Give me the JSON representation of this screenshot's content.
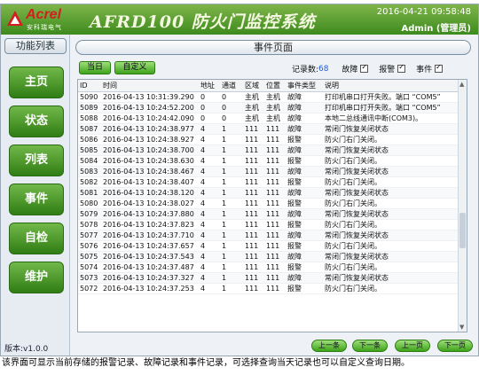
{
  "header": {
    "logo_text": "Acrel",
    "logo_sub": "安科瑞电气",
    "app_title": "AFRD100  防火门监控系统",
    "datetime": "2016-04-21 09:58:48",
    "user": "Admin (管理员)",
    "colors": {
      "bar": "#3d8a1e",
      "logo": "#d21f1f"
    }
  },
  "sidebar": {
    "title": "功能列表",
    "items": [
      {
        "label": "主页"
      },
      {
        "label": "状态"
      },
      {
        "label": "列表"
      },
      {
        "label": "事件"
      },
      {
        "label": "自检"
      },
      {
        "label": "维护"
      }
    ],
    "version": "版本:v1.0.0"
  },
  "main": {
    "page_title": "事件页面",
    "today_btn": "当日",
    "custom_btn": "自定义",
    "record_count_label": "记录数:",
    "record_count": "68",
    "filters": [
      {
        "label": "故障",
        "checked": true
      },
      {
        "label": "报警",
        "checked": true
      },
      {
        "label": "事件",
        "checked": true
      }
    ],
    "columns": [
      "ID",
      "时间",
      "地址",
      "通道",
      "区域",
      "位置",
      "事件类型",
      "说明"
    ],
    "rows": [
      [
        "5090",
        "2016-04-13 10:31:39.290",
        "0",
        "0",
        "主机",
        "主机",
        "故障",
        "打印机串口打开失败。端口 “COM5”"
      ],
      [
        "5089",
        "2016-04-13 10:24:52.200",
        "0",
        "0",
        "主机",
        "主机",
        "故障",
        "打印机串口打开失败。端口 “COM5”"
      ],
      [
        "5088",
        "2016-04-13 10:24:42.090",
        "0",
        "0",
        "主机",
        "主机",
        "故障",
        "本地二总线通讯中断(COM3)。"
      ],
      [
        "5087",
        "2016-04-13 10:24:38.977",
        "4",
        "1",
        "111",
        "111",
        "故障",
        "常闭门恢复关闭状态"
      ],
      [
        "5086",
        "2016-04-13 10:24:38.927",
        "4",
        "1",
        "111",
        "111",
        "报警",
        "防火门右门关闭。"
      ],
      [
        "5085",
        "2016-04-13 10:24:38.700",
        "4",
        "1",
        "111",
        "111",
        "故障",
        "常闭门恢复关闭状态"
      ],
      [
        "5084",
        "2016-04-13 10:24:38.630",
        "4",
        "1",
        "111",
        "111",
        "报警",
        "防火门右门关闭。"
      ],
      [
        "5083",
        "2016-04-13 10:24:38.467",
        "4",
        "1",
        "111",
        "111",
        "故障",
        "常闭门恢复关闭状态"
      ],
      [
        "5082",
        "2016-04-13 10:24:38.407",
        "4",
        "1",
        "111",
        "111",
        "报警",
        "防火门右门关闭。"
      ],
      [
        "5081",
        "2016-04-13 10:24:38.120",
        "4",
        "1",
        "111",
        "111",
        "故障",
        "常闭门恢复关闭状态"
      ],
      [
        "5080",
        "2016-04-13 10:24:38.027",
        "4",
        "1",
        "111",
        "111",
        "报警",
        "防火门右门关闭。"
      ],
      [
        "5079",
        "2016-04-13 10:24:37.880",
        "4",
        "1",
        "111",
        "111",
        "故障",
        "常闭门恢复关闭状态"
      ],
      [
        "5078",
        "2016-04-13 10:24:37.823",
        "4",
        "1",
        "111",
        "111",
        "报警",
        "防火门右门关闭。"
      ],
      [
        "5077",
        "2016-04-13 10:24:37.710",
        "4",
        "1",
        "111",
        "111",
        "故障",
        "常闭门恢复关闭状态"
      ],
      [
        "5076",
        "2016-04-13 10:24:37.657",
        "4",
        "1",
        "111",
        "111",
        "报警",
        "防火门右门关闭。"
      ],
      [
        "5075",
        "2016-04-13 10:24:37.543",
        "4",
        "1",
        "111",
        "111",
        "故障",
        "常闭门恢复关闭状态"
      ],
      [
        "5074",
        "2016-04-13 10:24:37.487",
        "4",
        "1",
        "111",
        "111",
        "报警",
        "防火门右门关闭。"
      ],
      [
        "5073",
        "2016-04-13 10:24:37.327",
        "4",
        "1",
        "111",
        "111",
        "故障",
        "常闭门恢复关闭状态"
      ],
      [
        "5072",
        "2016-04-13 10:24:37.253",
        "4",
        "1",
        "111",
        "111",
        "报警",
        "防火门右门关闭。"
      ]
    ],
    "pager": [
      "上一条",
      "下一条",
      "上一页",
      "下一页"
    ]
  },
  "caption": "该界面可显示当前存储的报警记录、故障记录和事件记录，可选择查询当天记录也可以自定义查询日期。"
}
